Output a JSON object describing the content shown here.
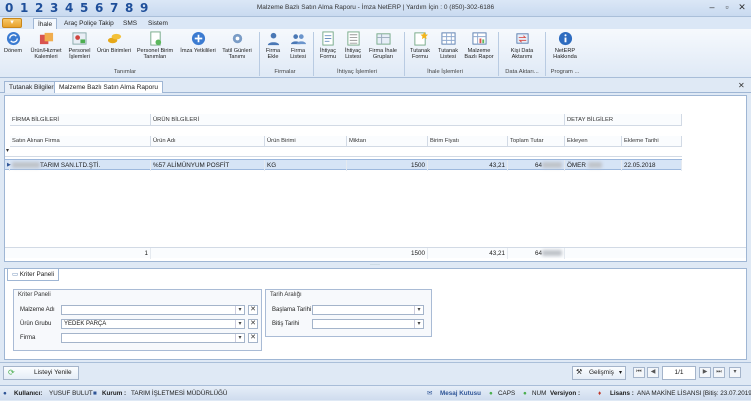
{
  "quick_numbers": [
    "0",
    "1",
    "2",
    "3",
    "4",
    "5",
    "6",
    "7",
    "8",
    "9"
  ],
  "app_title": "Malzeme Bazlı Satın Alma Raporu - İmza NetERP | Yardım İçin : 0 (850)-302-6186",
  "window": {
    "minimize": "–",
    "maximize": "▫",
    "close": "✕"
  },
  "ribbon_tabs": [
    "İhale",
    "Araç Poliçe Takip",
    "SMS",
    "Sistem"
  ],
  "ribbon": {
    "buttons": [
      {
        "label": "Dönem",
        "icon": "refresh-icon"
      },
      {
        "label": "Ürün/Hizmet Kalemleri",
        "icon": "products-icon"
      },
      {
        "label": "Personel İşlemleri",
        "icon": "personnel-icon"
      },
      {
        "label": "Ürün Birimleri",
        "icon": "coins-icon"
      },
      {
        "label": "Personel Birim Tanımları",
        "icon": "document-add-icon"
      },
      {
        "label": "İmza Yetkilileri",
        "icon": "add-circle-icon"
      },
      {
        "label": "Tatil Günleri Tanımı",
        "icon": "gear-icon"
      },
      {
        "label": "Firma Ekle",
        "icon": "person-icon"
      },
      {
        "label": "Firma Listesi",
        "icon": "people-icon"
      },
      {
        "label": "İhtiyaç Formu",
        "icon": "form-edit-icon"
      },
      {
        "label": "İhtiyaç Listesi",
        "icon": "list-icon"
      },
      {
        "label": "Firma İhale Grupları",
        "icon": "group-icon"
      },
      {
        "label": "Tutanak Formu",
        "icon": "report-star-icon"
      },
      {
        "label": "Tutanak Listesi",
        "icon": "table-icon"
      },
      {
        "label": "Malzeme Bazlı Rapor",
        "icon": "chart-report-icon"
      },
      {
        "label": "Kişi Data Aktarımı",
        "icon": "transfer-icon"
      },
      {
        "label": "NetERP Hakkında",
        "icon": "info-icon"
      }
    ],
    "groups": [
      "Tanımlar",
      "Firmalar",
      "İhtiyaç İşlemleri",
      "İhale İşlemleri",
      "Data Aktarı...",
      "Program ..."
    ]
  },
  "doc_tabs": [
    "Tutanak Bilgileri",
    "Malzeme Bazlı Satın Alma Raporu"
  ],
  "grid": {
    "bands": [
      "FİRMA BİLGİLERİ",
      "ÜRÜN BİLGİLERİ",
      "DETAY BİLGİLER"
    ],
    "columns": [
      "Satın Alınan Firma",
      "Ürün Adı",
      "Ürün Birimi",
      "Miktarı",
      "Birim Fiyatı",
      "Toplam Tutar",
      "Ekleyen",
      "Ekleme Tarihi"
    ],
    "filter_row_marker": "▾",
    "rows": [
      {
        "firma": "TARIM SAN.LTD.ŞTİ.",
        "urun": "%57 ALİMÜNYUM POSFİT",
        "birim": "KG",
        "miktar": "1500",
        "fiyat": "43,21",
        "toplam": "64",
        "ekleyen": "ÖMER",
        "tarih": "22.05.2018"
      }
    ],
    "footer": {
      "count": "1",
      "miktar": "1500",
      "fiyat": "43,21",
      "toplam": "64"
    }
  },
  "criteria": {
    "tab": "Kriter Paneli",
    "panel_title": "Kriter Paneli",
    "fields": [
      {
        "label": "Malzeme Adı",
        "value": ""
      },
      {
        "label": "Ürün Grubu",
        "value": "YEDEK PARÇA"
      },
      {
        "label": "Firma",
        "value": ""
      }
    ],
    "date_title": "Tarih Aralığı",
    "date_fields": [
      {
        "label": "Başlama Tarihi",
        "value": ""
      },
      {
        "label": "Bitiş Tarihi",
        "value": ""
      }
    ]
  },
  "bottom": {
    "refresh": "Listeyi Yenile",
    "advanced": "Gelişmiş",
    "page": "1/1"
  },
  "status": {
    "user_label": "Kullanıcı:",
    "user": "YUSUF BULUT",
    "org_label": "Kurum :",
    "org": "TARIM İŞLETMESİ MÜDÜRLÜĞÜ",
    "mail": "Mesaj Kutusu",
    "caps": "CAPS",
    "num": "NUM",
    "version_label": "Versiyon :",
    "license_label": "Lisans :",
    "license": "ANA MAKİNE LİSANSI [Bitiş: 23.07.2019]"
  }
}
